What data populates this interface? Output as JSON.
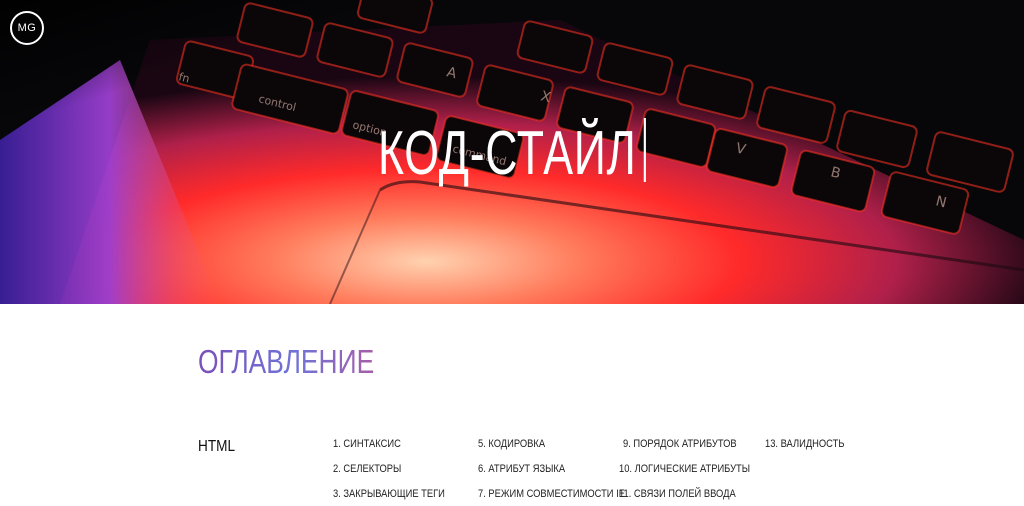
{
  "header": {
    "logo_text": "MG",
    "hero_title": "КОД-СТАЙЛ"
  },
  "toc": {
    "heading": "ОГЛАВЛЕНИЕ",
    "section": "HTML",
    "items": [
      "1. СИНТАКСИС",
      "2. СЕЛЕКТОРЫ",
      "3. ЗАКРЫВАЮЩИЕ ТЕГИ",
      "5. КОДИРОВКА",
      "6. АТРИБУТ ЯЗЫКА",
      "7. РЕЖИМ СОВМЕСТИМОСТИ IE",
      "9. ПОРЯДОК АТРИБУТОВ",
      "10. ЛОГИЧЕСКИЕ АТРИБУТЫ",
      "11. СВЯЗИ ПОЛЕЙ ВВОДА",
      "13. ВАЛИДНОСТЬ"
    ]
  },
  "colors": {
    "heading_gradient": [
      "#7a4fb8",
      "#6f74d8",
      "#a65da8"
    ],
    "hero_glow": [
      "#ff3a1e",
      "#ff8a5c",
      "#c24bd6",
      "#5b2ab8"
    ]
  }
}
